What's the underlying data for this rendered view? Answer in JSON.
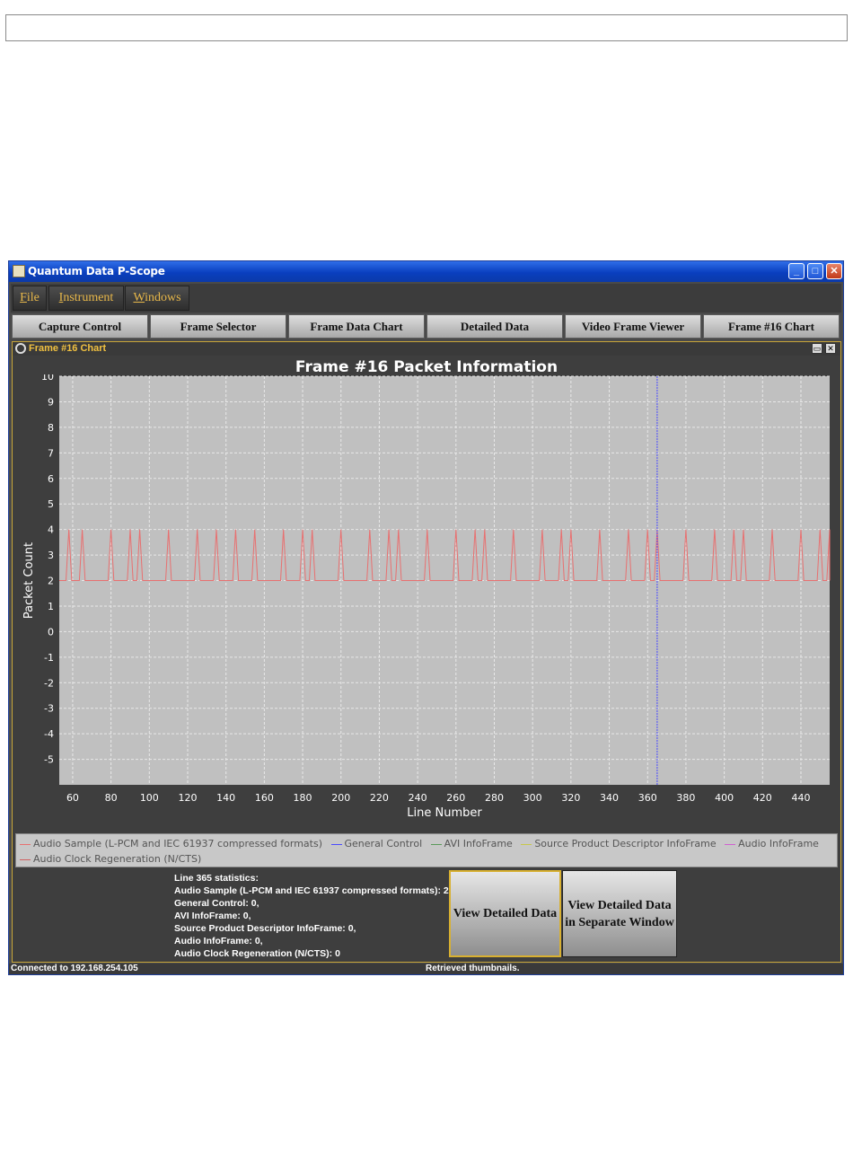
{
  "window": {
    "title": "Quantum Data P-Scope"
  },
  "menu": {
    "items": [
      {
        "label": "File",
        "hotkey_index": 0
      },
      {
        "label": "Instrument",
        "hotkey_index": 0
      },
      {
        "label": "Windows",
        "hotkey_index": 0
      }
    ]
  },
  "tabs": [
    "Capture Control",
    "Frame Selector",
    "Frame Data Chart",
    "Detailed Data",
    "Video Frame Viewer",
    "Frame #16 Chart"
  ],
  "panel": {
    "title": "Frame #16 Chart"
  },
  "chart_data": {
    "type": "line",
    "title": "Frame #16 Packet Information",
    "xlabel": "Line Number",
    "ylabel": "Packet Count",
    "xlim": [
      53,
      455
    ],
    "ylim": [
      -6,
      10
    ],
    "xticks": [
      60,
      80,
      100,
      120,
      140,
      160,
      180,
      200,
      220,
      240,
      260,
      280,
      300,
      320,
      340,
      360,
      380,
      400,
      420,
      440
    ],
    "yticks": [
      10,
      9,
      8,
      7,
      6,
      5,
      4,
      3,
      2,
      1,
      0,
      -1,
      -2,
      -3,
      -4,
      -5
    ],
    "grid": true,
    "cursor_x": 365,
    "series": [
      {
        "name": "Audio Sample (L-PCM and IEC 61937 compressed formats)",
        "color": "#e87070",
        "baseline": 2,
        "peak": 4,
        "spike_x": [
          58,
          65,
          80,
          90,
          95,
          110,
          125,
          135,
          145,
          155,
          170,
          180,
          185,
          200,
          215,
          225,
          230,
          245,
          260,
          270,
          275,
          290,
          305,
          315,
          320,
          335,
          350,
          360,
          365,
          380,
          395,
          405,
          410,
          425,
          440,
          450,
          455
        ]
      },
      {
        "name": "General Control",
        "color": "#4a4aff"
      },
      {
        "name": "AVI InfoFrame",
        "color": "#5a9a5a"
      },
      {
        "name": "Source Product Descriptor InfoFrame",
        "color": "#c8c84a"
      },
      {
        "name": "Audio InfoFrame",
        "color": "#d060d0"
      },
      {
        "name": "Audio Clock Regeneration (N/CTS)",
        "color": "#d06060"
      }
    ]
  },
  "stats": {
    "lines": [
      "Line 365 statistics:",
      "Audio Sample (L-PCM and IEC 61937 compressed formats): 2,",
      "General Control: 0,",
      "AVI InfoFrame: 0,",
      "Source Product Descriptor InfoFrame: 0,",
      "Audio InfoFrame: 0,",
      "Audio Clock Regeneration (N/CTS): 0"
    ]
  },
  "buttons": {
    "view_detailed": "View Detailed Data",
    "view_separate_1": "View Detailed Data",
    "view_separate_2": "in Separate Window"
  },
  "status": {
    "left": "Connected to 192.168.254.105",
    "right": "Retrieved thumbnails."
  }
}
